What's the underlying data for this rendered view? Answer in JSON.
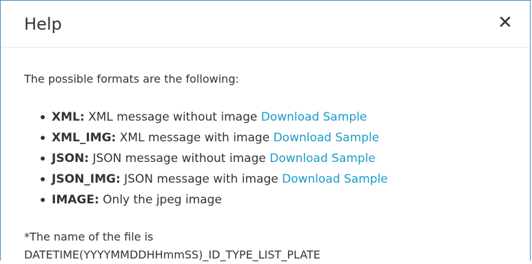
{
  "dialog": {
    "title": "Help",
    "close_label": "✕"
  },
  "intro": "The possible formats are the following:",
  "formats": [
    {
      "name": "XML:",
      "description": "XML message without image",
      "link": "Download Sample"
    },
    {
      "name": "XML_IMG:",
      "description": "XML message with image",
      "link": "Download Sample"
    },
    {
      "name": "JSON:",
      "description": "JSON message without image",
      "link": "Download Sample"
    },
    {
      "name": "JSON_IMG:",
      "description": "JSON message with image",
      "link": "Download Sample"
    },
    {
      "name": "IMAGE:",
      "description": "Only the jpeg image",
      "link": null
    }
  ],
  "note": {
    "line1": "*The name of the file is",
    "line2": "DATETIME(YYYYMMDDHHmmSS)_ID_TYPE_LIST_PLATE"
  },
  "colors": {
    "link": "#1a9bc9",
    "border": "#4a86c8",
    "text": "#333333"
  }
}
